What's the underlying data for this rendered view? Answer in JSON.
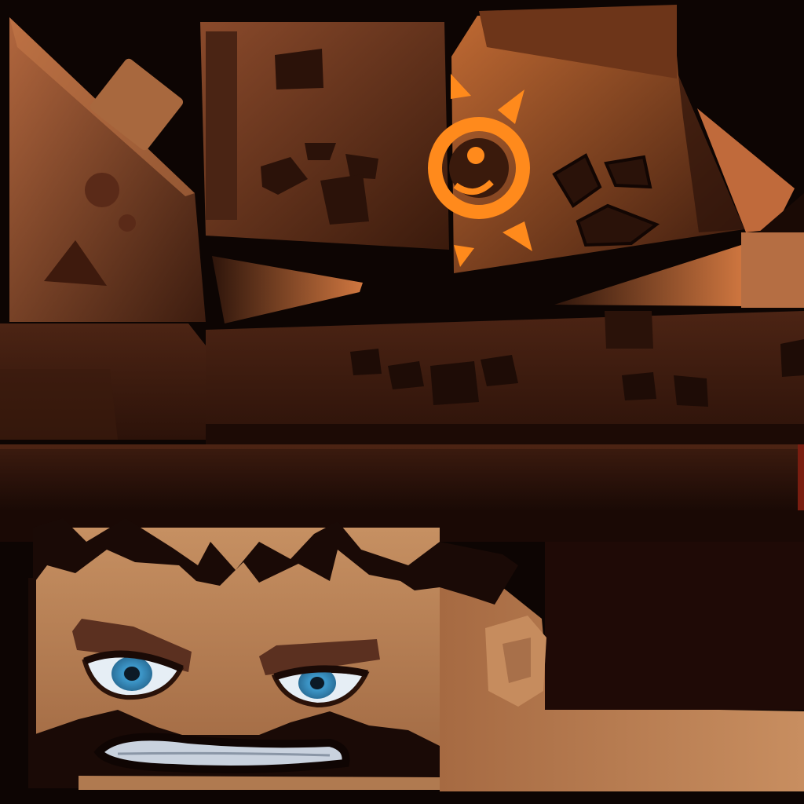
{
  "scene": {
    "subject": "game-character-texture-atlas",
    "palette": {
      "background": "#0d0503",
      "hat_dark": "#2a1109",
      "hat_mid": "#4a2414",
      "hat_light": "#8a4a2c",
      "stone_light": "#b86a3c",
      "skin": "#c4895b",
      "skin_shadow": "#8f5a36",
      "hair": "#1a0a06",
      "brow": "#5b3020",
      "eye_iris": "#3d97c9",
      "eye_white": "#e6eef5",
      "sun_emblem": "#ff8a1c",
      "teeth": "#c9d2de"
    }
  }
}
